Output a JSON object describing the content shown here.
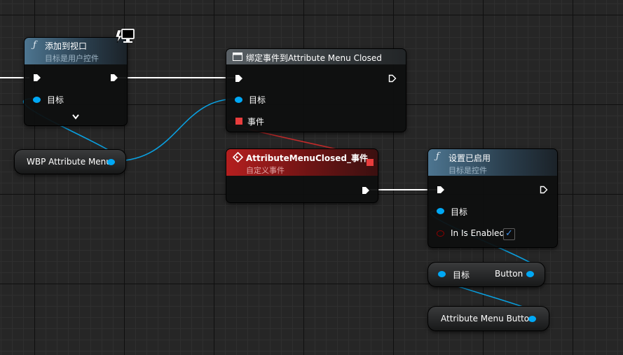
{
  "graph": {
    "nodes": {
      "add_to_viewport": {
        "title": "添加到视口",
        "subtitle": "目标是用户控件",
        "pins": {
          "target": "目标"
        },
        "expand_icon": "chevron-down-icon",
        "badge_icon": "client-only-icon"
      },
      "bind_event": {
        "title": "绑定事件到Attribute Menu Closed",
        "pins": {
          "target": "目标",
          "event": "事件"
        }
      },
      "custom_event": {
        "title": "AttributeMenuClosed_事件",
        "subtitle": "自定义事件"
      },
      "set_enabled": {
        "title": "设置已启用",
        "subtitle": "目标是控件",
        "pins": {
          "target": "目标",
          "in_is_enabled": "In Is Enabled"
        },
        "in_is_enabled_value": true
      },
      "wbp_attribute_menu": {
        "label": "WBP Attribute Menu"
      },
      "get_button": {
        "input_label": "目标",
        "output_label": "Button"
      },
      "attribute_menu_button": {
        "label": "Attribute Menu Button"
      }
    },
    "colors": {
      "exec_wire": "#ffffff",
      "object_pin": "#00a8f5",
      "delegate_pin": "#e93d3d",
      "bool_pin": "#8b0000",
      "event_header": "#b41f1f",
      "function_header": "#4d7590"
    }
  }
}
